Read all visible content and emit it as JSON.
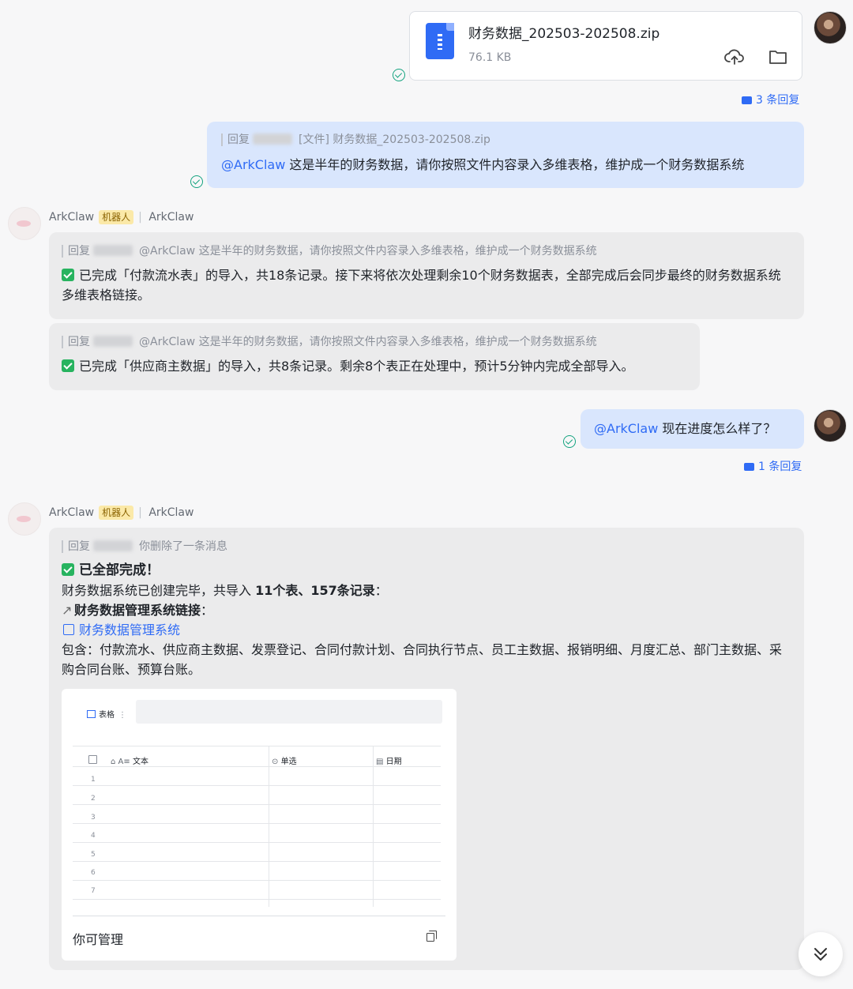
{
  "file_message": {
    "file_name": "财务数据_202503-202508.zip",
    "file_size": "76.1 KB",
    "reply_count_label": "3 条回复"
  },
  "user_message_1": {
    "quote_prefix": "回复",
    "quote_text": "[文件] 财务数据_202503-202508.zip",
    "mention": "@ArkClaw",
    "text": "这是半年的财务数据，请你按照文件内容录入多维表格，维护成一个财务数据系统"
  },
  "bot_header": {
    "name": "ArkClaw",
    "tag": "机器人",
    "separator": "|",
    "source": "ArkClaw"
  },
  "bot_reply_1": {
    "quote_prefix": "回复",
    "quote_text": "@ArkClaw 这是半年的财务数据，请你按照文件内容录入多维表格，维护成一个财务数据系统",
    "text": "已完成「付款流水表」的导入，共18条记录。接下来将依次处理剩余10个财务数据表，全部完成后会同步最终的财务数据系统多维表格链接。"
  },
  "bot_reply_2": {
    "quote_prefix": "回复",
    "quote_text": "@ArkClaw 这是半年的财务数据，请你按照文件内容录入多维表格，维护成一个财务数据系统",
    "text": "已完成「供应商主数据」的导入，共8条记录。剩余8个表正在处理中，预计5分钟内完成全部导入。"
  },
  "user_message_2": {
    "mention": "@ArkClaw",
    "text": "现在进度怎么样了？",
    "reply_count_label": "1 条回复"
  },
  "bot_reply_3": {
    "quote_prefix": "回复",
    "quote_text": "你删除了一条消息",
    "done_title": "已全部完成！",
    "summary_prefix": "财务数据系统已创建完毕，共导入 ",
    "summary_bold": "11个表、157条记录",
    "summary_suffix": "：",
    "link_heading": "财务数据管理系统链接",
    "link_heading_suffix": "：",
    "link_text": "财务数据管理系统",
    "contents": "包含：付款流水、供应商主数据、发票登记、合同付款计划、合同执行节点、员工主数据、报销明细、月度汇总、部门主数据、采购合同台账、预算台账。"
  },
  "embed_card": {
    "view_label": "表格",
    "columns": [
      "文本",
      "单选",
      "日期"
    ],
    "row_numbers": [
      "1",
      "2",
      "3",
      "4",
      "5",
      "6",
      "7"
    ],
    "footer_text": "你可管理"
  }
}
